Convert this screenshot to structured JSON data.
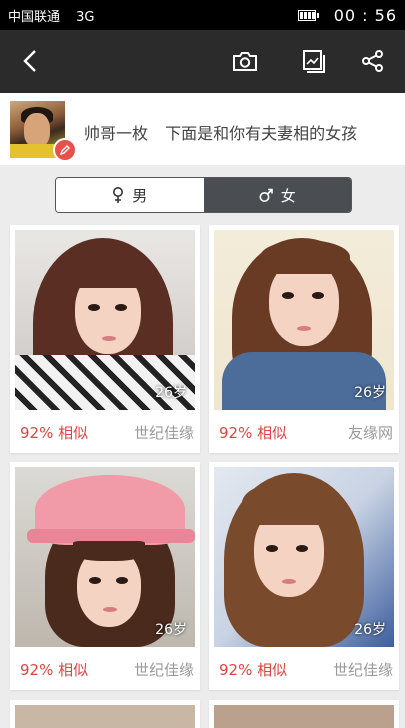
{
  "status_bar": {
    "carrier": "中国联通",
    "network": "3G",
    "time": "00 : 56"
  },
  "toolbar": {
    "icons": [
      "back-arrow-icon",
      "camera-icon",
      "gallery-icon",
      "share-icon"
    ]
  },
  "user": {
    "name": "帅哥一枚",
    "caption": "下面是和你有夫妻相的女孩"
  },
  "gender_toggle": {
    "male_label": "男",
    "female_label": "女",
    "selected": "female"
  },
  "colors": {
    "toolbar_bg": "#2b2b2b",
    "accent_red": "#e2433f",
    "segment_selected": "#4a4d52",
    "page_bg": "#ececec"
  },
  "results": [
    {
      "age": "26岁",
      "similarity": "92% 相似",
      "source": "世纪佳缘"
    },
    {
      "age": "26岁",
      "similarity": "92% 相似",
      "source": "友缘网"
    },
    {
      "age": "26岁",
      "similarity": "92% 相似",
      "source": "世纪佳缘"
    },
    {
      "age": "26岁",
      "similarity": "92% 相似",
      "source": "世纪佳缘"
    }
  ]
}
